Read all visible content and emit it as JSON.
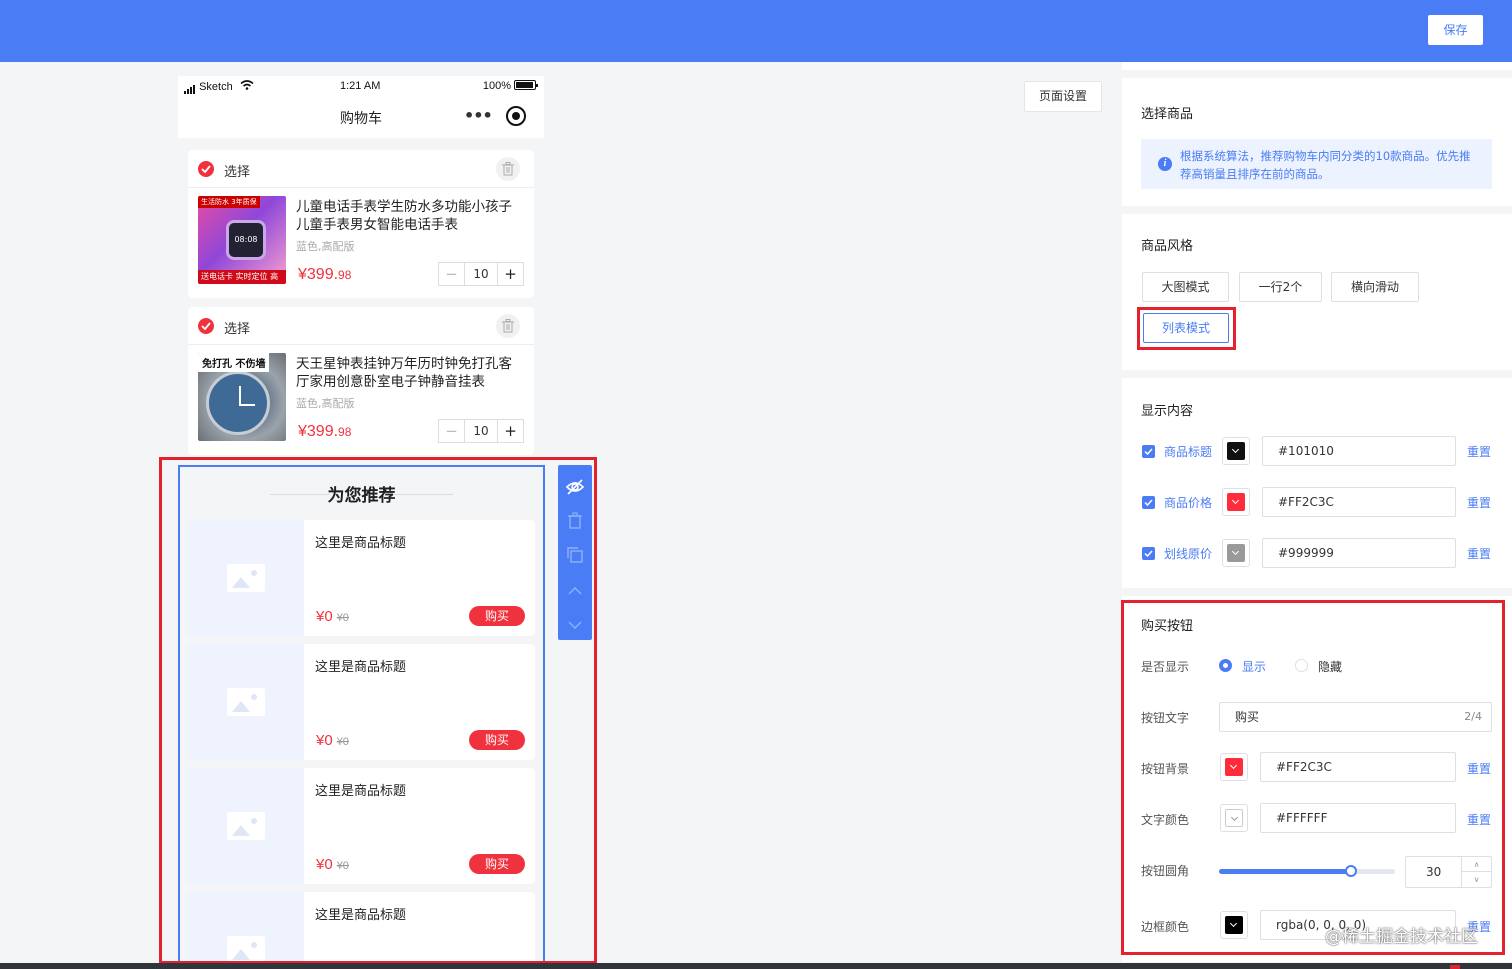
{
  "header": {
    "save_label": "保存"
  },
  "page_settings_label": "页面设置",
  "phone": {
    "status": {
      "carrier": "Sketch",
      "time": "1:21 AM",
      "battery": "100%"
    },
    "nav_title": "购物车",
    "nav_dots": "•••"
  },
  "cart": [
    {
      "select_label": "选择",
      "title": "儿童电话手表学生防水多功能小孩子儿童手表男女智能电话手表",
      "spec": "蓝色,高配版",
      "price_int": "¥399.",
      "price_dec": "98",
      "qty": "10",
      "minus": "−",
      "plus": "+",
      "tag": "生活防水 3年质保",
      "screen_text": "08:08",
      "bottom_text": "送电话卡 实时定位 高清通话",
      "icon": "smartwatch-product-image"
    },
    {
      "select_label": "选择",
      "title": "天王星钟表挂钟万年历时钟免打孔客厅家用创意卧室电子钟静音挂表",
      "spec": "蓝色,高配版",
      "price_int": "¥399.",
      "price_dec": "98",
      "qty": "10",
      "minus": "−",
      "plus": "+",
      "tag": "免打孔 不伤墙",
      "icon": "wall-clock-product-image"
    }
  ],
  "recommend": {
    "title": "为您推荐",
    "items": [
      {
        "title": "这里是商品标题",
        "price": "¥0",
        "orig": "¥0",
        "buy": "购买"
      },
      {
        "title": "这里是商品标题",
        "price": "¥0",
        "orig": "¥0",
        "buy": "购买"
      },
      {
        "title": "这里是商品标题",
        "price": "¥0",
        "orig": "¥0",
        "buy": "购买"
      },
      {
        "title": "这里是商品标题",
        "price": "¥0",
        "orig": "¥0",
        "buy": "购买"
      }
    ]
  },
  "side_tools": [
    "eye-off-icon",
    "trash-icon",
    "copy-icon",
    "arrow-up-icon",
    "arrow-down-icon"
  ],
  "panel": {
    "select_goods": {
      "title": "选择商品",
      "notice": "根据系统算法，推荐购物车内同分类的10款商品。优先推荐高销量且排序在前的商品。",
      "notice_icon": "i"
    },
    "style": {
      "title": "商品风格",
      "options": [
        "大图模式",
        "一行2个",
        "横向滑动",
        "列表模式"
      ],
      "selected": "列表模式"
    },
    "display": {
      "title": "显示内容",
      "rows": [
        {
          "label": "商品标题",
          "color": "#101010",
          "reset": "重置",
          "checked": true
        },
        {
          "label": "商品价格",
          "color": "#FF2C3C",
          "reset": "重置",
          "checked": true
        },
        {
          "label": "划线原价",
          "color": "#999999",
          "reset": "重置",
          "checked": true
        }
      ]
    },
    "buy_button": {
      "title": "购买按钮",
      "show_label": "是否显示",
      "show_options": [
        "显示",
        "隐藏"
      ],
      "show_selected": "显示",
      "text_label": "按钮文字",
      "text_value": "购买",
      "text_counter": "2/4",
      "bg_label": "按钮背景",
      "bg_color": "#FF2C3C",
      "bg_reset": "重置",
      "font_color_label": "文字颜色",
      "font_color": "#FFFFFF",
      "font_reset": "重置",
      "radius_label": "按钮圆角",
      "radius_value": "30",
      "radius_fraction": 0.75,
      "border_label": "边框颜色",
      "border_color": "rgba(0, 0, 0, 0)",
      "border_reset": "重置"
    }
  },
  "watermark": "@稀土掘金技术社区",
  "colors": {
    "accent": "#4A7CF6",
    "price": "#F0323E",
    "highlight": "#E3222D"
  }
}
